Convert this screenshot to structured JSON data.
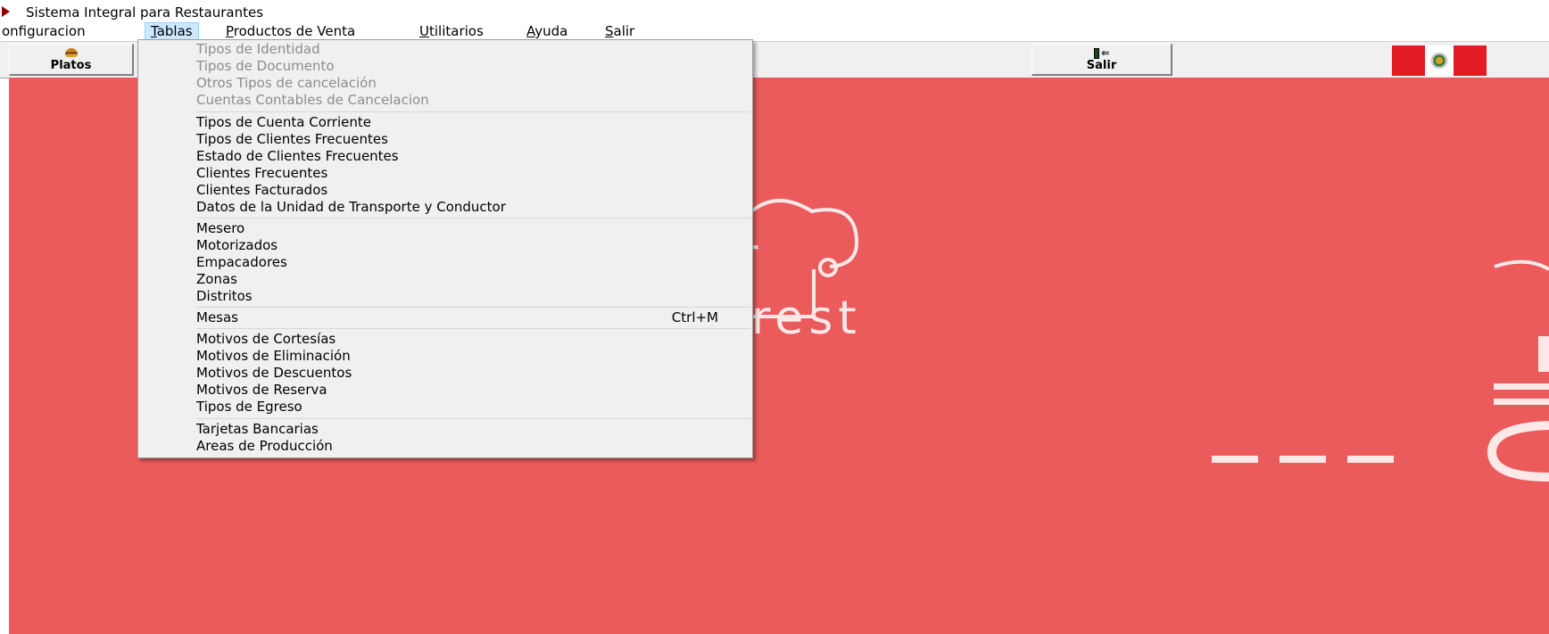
{
  "window": {
    "title": "Sistema Integral para Restaurantes"
  },
  "menubar": [
    {
      "label": "Configuracion",
      "accel": "C",
      "rest": "onfiguracion",
      "pre": ""
    },
    {
      "label": "Tablas",
      "accel": "T",
      "rest": "ablas",
      "pre": ""
    },
    {
      "label": "Productos de Venta",
      "accel": "P",
      "rest": "roductos de Venta",
      "pre": ""
    },
    {
      "label": "Utilitarios",
      "accel": "U",
      "rest": "tilitarios",
      "pre": ""
    },
    {
      "label": "Ayuda",
      "accel": "A",
      "rest": "yuda",
      "pre": ""
    },
    {
      "label": "Salir",
      "accel": "S",
      "rest": "alir",
      "pre": ""
    }
  ],
  "toolbar": {
    "platos_label": "Platos",
    "salir_label": "Salir"
  },
  "workspace": {
    "background": "#eb5b5b",
    "logo_fragment_1": "r",
    "logo_fragment_2": "rest"
  },
  "tablas_menu": {
    "items": [
      {
        "label": "Tipos de Identidad",
        "enabled": false
      },
      {
        "label": "Tipos de Documento",
        "enabled": false
      },
      {
        "label": "Otros Tipos de cancelación",
        "enabled": false
      },
      {
        "label": "Cuentas Contables de Cancelacion",
        "enabled": false
      },
      {
        "label": "Tipos de Cuenta Corriente",
        "enabled": true
      },
      {
        "label": "Tipos de Clientes Frecuentes",
        "enabled": true
      },
      {
        "label": "Estado de Clientes Frecuentes",
        "enabled": true
      },
      {
        "label": "Clientes Frecuentes",
        "enabled": true
      },
      {
        "label": "Clientes Facturados",
        "enabled": true
      },
      {
        "label": "Datos de la Unidad de Transporte y Conductor",
        "enabled": true
      },
      {
        "label": "Mesero",
        "enabled": true
      },
      {
        "label": "Motorizados",
        "enabled": true
      },
      {
        "label": "Empacadores",
        "enabled": true
      },
      {
        "label": "Zonas",
        "enabled": true
      },
      {
        "label": "Distritos",
        "enabled": true
      },
      {
        "label": "Mesas",
        "enabled": true,
        "shortcut": "Ctrl+M"
      },
      {
        "label": "Motivos de Cortesías",
        "enabled": true
      },
      {
        "label": "Motivos de Eliminación",
        "enabled": true
      },
      {
        "label": "Motivos de Descuentos",
        "enabled": true
      },
      {
        "label": "Motivos de Reserva",
        "enabled": true
      },
      {
        "label": "Tipos de Egreso",
        "enabled": true
      },
      {
        "label": "Tarjetas Bancarias",
        "enabled": true
      },
      {
        "label": "Areas de Producción",
        "enabled": true
      }
    ]
  },
  "icons": {
    "app": "app-icon",
    "platos": "burger-icon",
    "salir": "exit-door-icon",
    "flag": "peru-flag-icon"
  }
}
